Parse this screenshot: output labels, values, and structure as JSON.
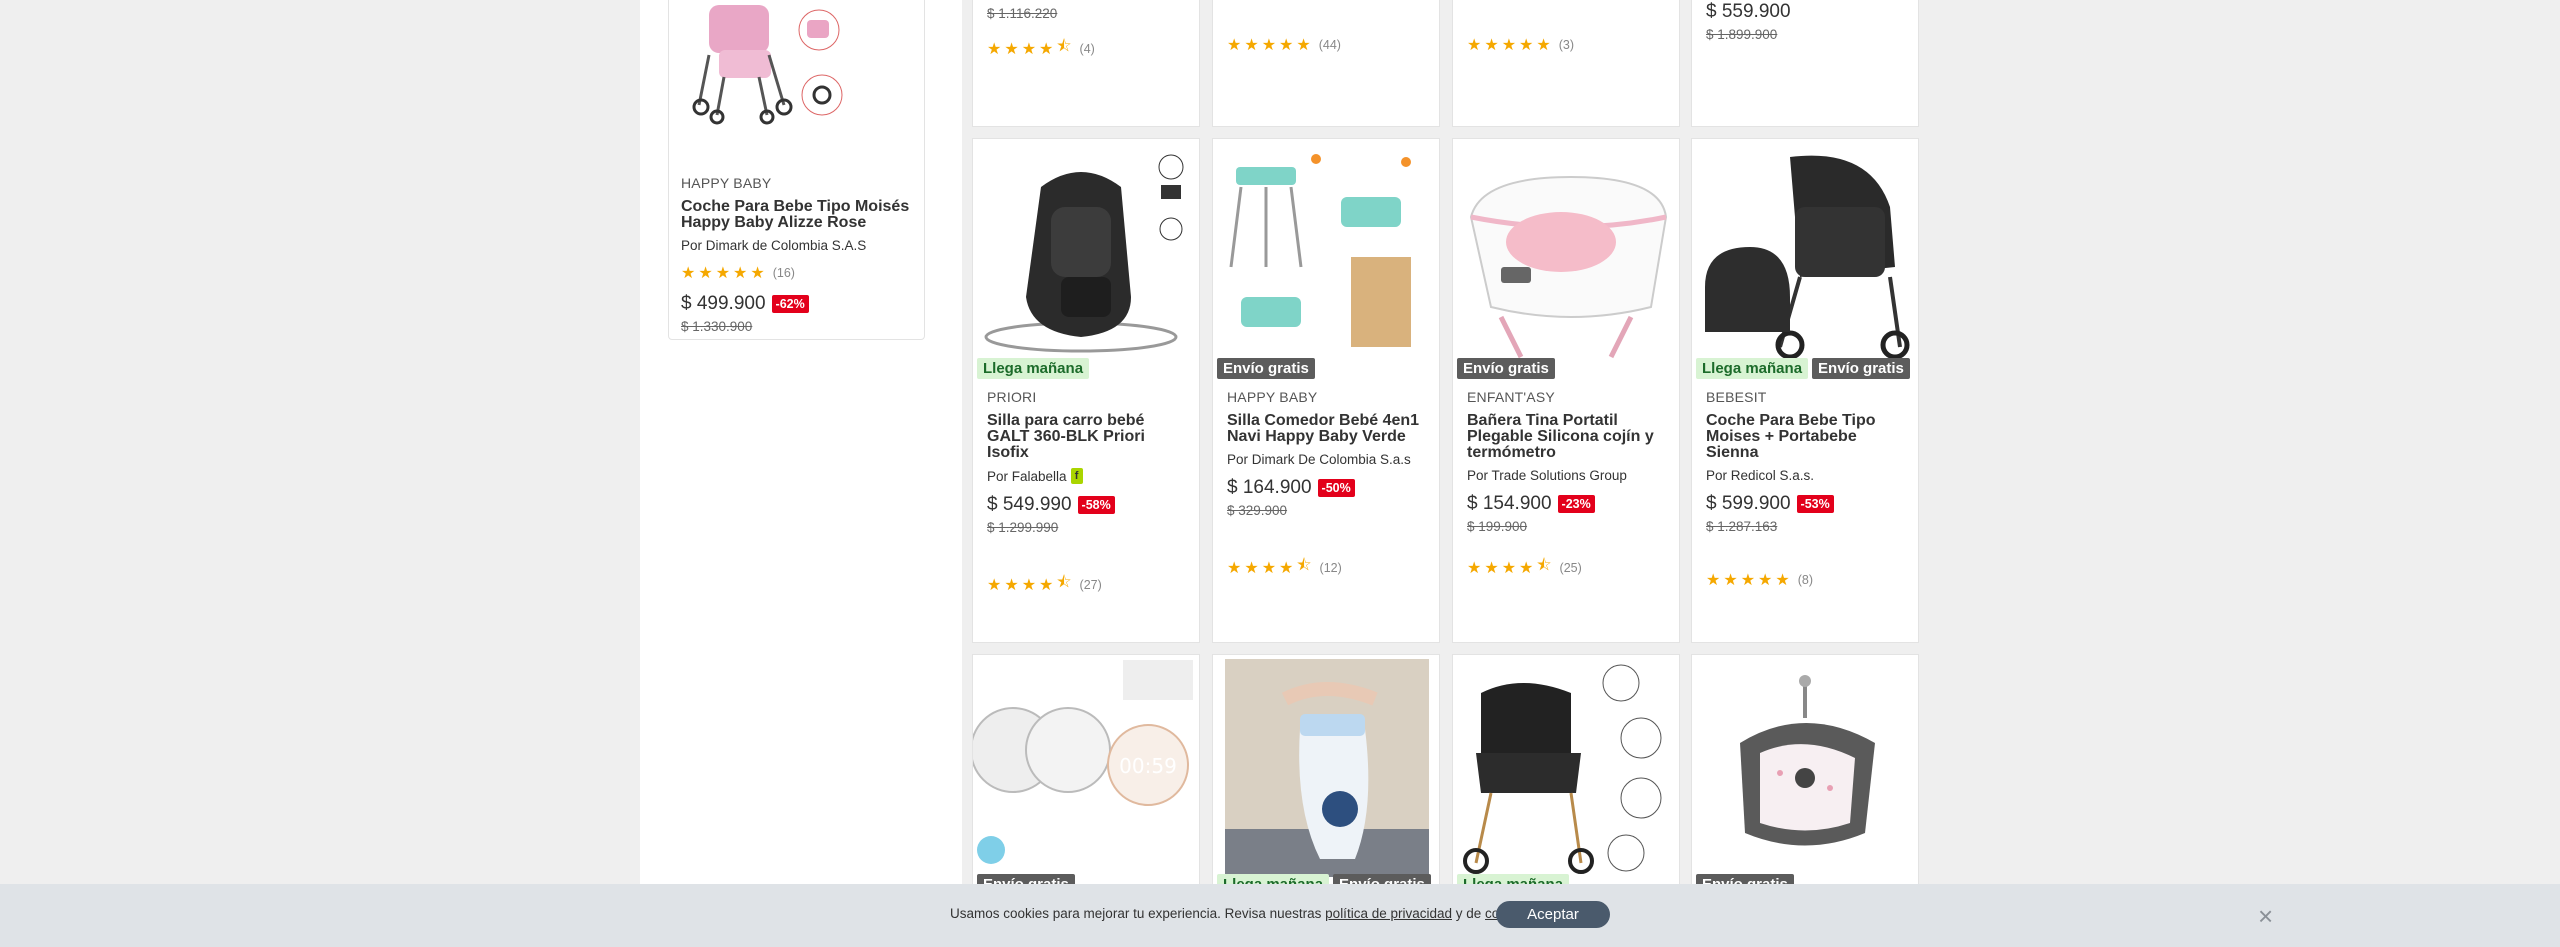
{
  "top_row": [
    {
      "old_price": "$ 1.116.220",
      "rating_count": "(4)",
      "stars": 4.5
    },
    {
      "rating_count": "(44)",
      "stars": 5
    },
    {
      "rating_count": "(3)",
      "stars": 5
    },
    {
      "price": "$ 559.900",
      "old_price": "$ 1.899.900"
    }
  ],
  "side_card": {
    "brand": "HAPPY BABY",
    "title": "Coche Para Bebe Tipo Moisés Happy Baby Alizze Rose",
    "seller": "Por Dimark de Colombia S.A.S",
    "rating_count": "(16)",
    "stars": 5,
    "price": "$ 499.900",
    "discount": "-62%",
    "old_price": "$ 1.330.900"
  },
  "products": [
    {
      "badges": [
        "Llega mañana"
      ],
      "brand": "PRIORI",
      "title": "Silla para carro bebé GALT 360-BLK Priori Isofix",
      "seller": "Por Falabella",
      "seller_logo": "f",
      "price": "$ 549.990",
      "discount": "-58%",
      "old_price": "$ 1.299.990",
      "rating_count": "(27)",
      "stars": 4.5
    },
    {
      "badges": [
        "Envío gratis"
      ],
      "brand": "HAPPY BABY",
      "title": "Silla Comedor Bebé 4en1 Navi Happy Baby Verde",
      "seller": "Por Dimark De Colombia S.a.s",
      "price": "$ 164.900",
      "discount": "-50%",
      "old_price": "$ 329.900",
      "rating_count": "(12)",
      "stars": 4.5
    },
    {
      "badges": [
        "Envío gratis"
      ],
      "brand": "ENFANT'ASY",
      "title": "Bañera Tina Portatil Plegable Silicona cojín y termómetro",
      "seller": "Por Trade Solutions Group",
      "price": "$ 154.900",
      "discount": "-23%",
      "old_price": "$ 199.900",
      "rating_count": "(25)",
      "stars": 4.5
    },
    {
      "badges": [
        "Llega mañana",
        "Envío gratis"
      ],
      "brand": "BEBESIT",
      "title": "Coche Para Bebe Tipo Moises + Portabebe Sienna",
      "seller": "Por Redicol S.a.s.",
      "price": "$ 599.900",
      "discount": "-53%",
      "old_price": "$ 1.287.163",
      "rating_count": "(8)",
      "stars": 5
    }
  ],
  "bottom_row": [
    {
      "badges": [
        "Envío gratis"
      ],
      "screen_text": "00:59"
    },
    {
      "badges": [
        "Llega mañana",
        "Envío gratis"
      ]
    },
    {
      "badges": [
        "Llega mañana"
      ]
    },
    {
      "badges": [
        "Envío gratis"
      ]
    }
  ],
  "cookie": {
    "text_before": "Usamos cookies para mejorar tu experiencia. Revisa nuestras ",
    "privacy_link": "política de privacidad",
    "text_middle": " y de ",
    "cookies_link": "cookies",
    "text_after": ".",
    "accept_label": "Aceptar",
    "close_icon": "×"
  },
  "colors": {
    "discount": "#e3001b",
    "star": "#f5a800",
    "badge_green_bg": "#d8f3d3",
    "badge_gray_bg": "#5c5c5c",
    "accept_bg": "#4a5a6c"
  }
}
